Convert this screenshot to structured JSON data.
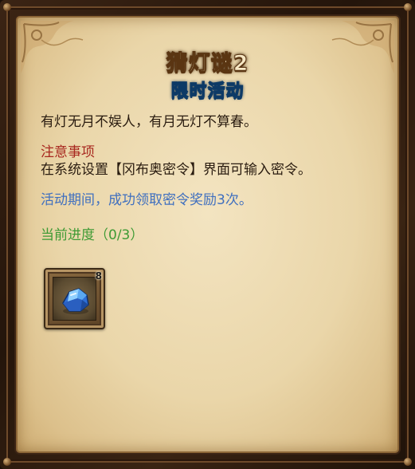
{
  "panel": {
    "title": "猜灯谜2",
    "subtitle": "限时活动"
  },
  "content": {
    "riddle": "有灯无月不娱人，有月无灯不算春。",
    "notice_heading": "注意事项",
    "notice_text": "在系统设置【冈布奥密令】界面可输入密令。",
    "event_info": "活动期间，成功领取密令奖励3次。",
    "progress_text": "当前进度（0/3）"
  },
  "reward": {
    "icon": "blue-crystal-icon",
    "count": "8"
  },
  "colors": {
    "notice_heading": "#a8281f",
    "event_info": "#3f6fbf",
    "progress": "#3e9a34",
    "subtitle": "#bfe6ff"
  }
}
